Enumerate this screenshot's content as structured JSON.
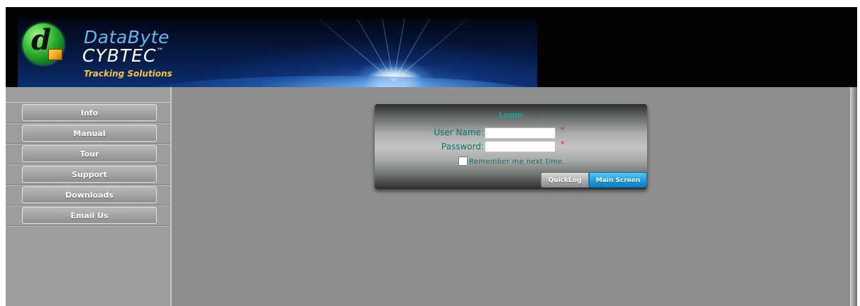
{
  "header": {
    "brand_name": "DataByte",
    "brand_sub": "CYBTEC",
    "brand_trademark": "™",
    "brand_tagline": "Tracking Solutions",
    "logo_icon": "databyte-logo-icon"
  },
  "sidebar": {
    "items": [
      {
        "label": "Info"
      },
      {
        "label": "Manual"
      },
      {
        "label": "Tour"
      },
      {
        "label": "Support"
      },
      {
        "label": "Downloads"
      },
      {
        "label": "Email Us"
      }
    ]
  },
  "login": {
    "title": "Login",
    "username_label": "User Name:",
    "username_value": "",
    "password_label": "Password:",
    "password_value": "",
    "required_marker": "*",
    "remember_label": "Remember me next time.",
    "remember_checked": false,
    "quicklog_label": "QuickLog",
    "main_screen_label": "Main Screen"
  },
  "colors": {
    "accent_teal": "#18a6a0",
    "label_teal": "#0e6f6a",
    "primary_button": "#1da3e6",
    "required": "#e02020",
    "brand_blue": "#62b7ec",
    "tagline_gold": "#f4c541"
  }
}
